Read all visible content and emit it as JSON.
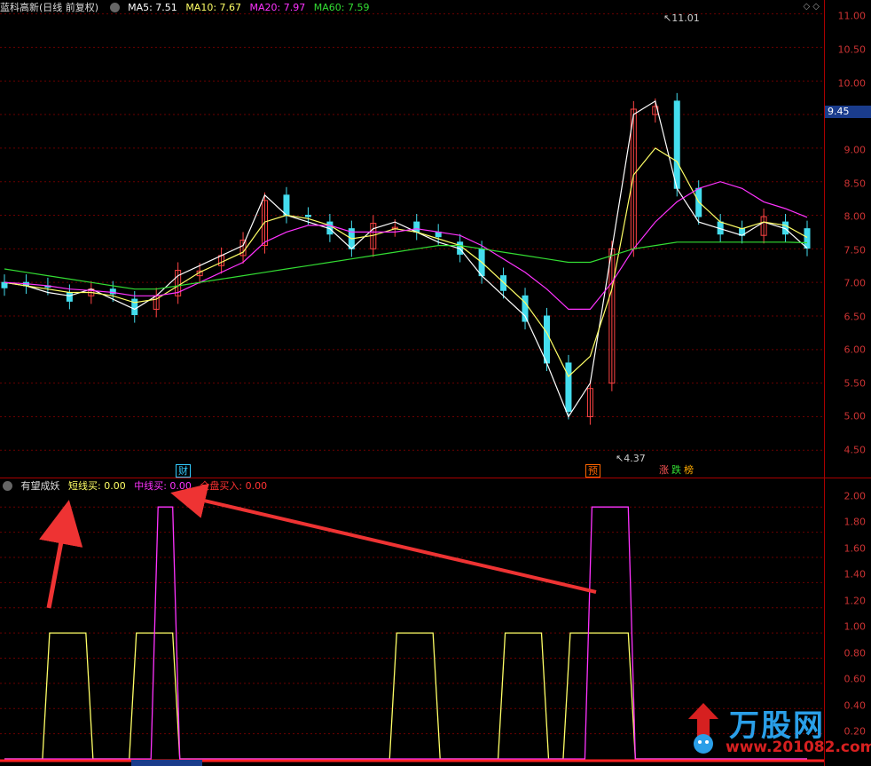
{
  "main_panel": {
    "title": "蓝科高新(日线 前复权)",
    "ma": [
      {
        "label": "MA5: 7.51",
        "color": "#ffffff"
      },
      {
        "label": "MA10: 7.67",
        "color": "#ffff66"
      },
      {
        "label": "MA20: 7.97",
        "color": "#ff33ff"
      },
      {
        "label": "MA60: 7.59",
        "color": "#33dd33"
      }
    ],
    "y_ticks": [
      "11.00",
      "10.50",
      "10.00",
      "9.45",
      "9.00",
      "8.50",
      "8.00",
      "7.50",
      "7.00",
      "6.50",
      "6.00",
      "5.50",
      "5.00",
      "4.50"
    ],
    "current_price": "9.45",
    "high_label": "11.01",
    "low_label": "4.37",
    "markers": [
      {
        "text": "财",
        "color": "#33ccff"
      },
      {
        "text": "预",
        "color": "#ff6600"
      },
      {
        "text": "涨",
        "color": "#ff5555"
      },
      {
        "text": "跌",
        "color": "#33dd33"
      },
      {
        "text": "榜",
        "color": "#ffaa00"
      }
    ],
    "window_controls": "◇ ◇"
  },
  "indicator_panel": {
    "title": "有望成妖",
    "series": [
      {
        "label": "短线买: 0.00",
        "color": "#ffff66"
      },
      {
        "label": "中线买: 0.00",
        "color": "#ff33ff"
      },
      {
        "label": "全盘买入: 0.00",
        "color": "#ff3333"
      }
    ],
    "y_ticks": [
      "2.00",
      "1.80",
      "1.60",
      "1.40",
      "1.20",
      "1.00",
      "0.80",
      "0.60",
      "0.40",
      "0.20"
    ]
  },
  "chart_data": [
    {
      "type": "line",
      "title": "蓝科高新(日线 前复权)",
      "ylim": [
        4.2,
        11.1
      ],
      "grid": true,
      "series": [
        {
          "name": "MA5",
          "values": [
            7.0,
            6.95,
            6.85,
            6.8,
            6.9,
            6.75,
            6.6,
            6.8,
            7.1,
            7.25,
            7.4,
            7.55,
            8.3,
            8.0,
            7.9,
            7.8,
            7.5,
            7.8,
            7.9,
            7.75,
            7.6,
            7.5,
            7.1,
            6.8,
            6.5,
            5.8,
            5.0,
            5.5,
            7.5,
            9.5,
            9.7,
            8.4,
            7.9,
            7.8,
            7.7,
            7.9,
            7.8,
            7.51
          ]
        },
        {
          "name": "MA10",
          "values": [
            7.0,
            6.95,
            6.9,
            6.85,
            6.85,
            6.8,
            6.7,
            6.75,
            6.95,
            7.15,
            7.3,
            7.45,
            7.9,
            8.0,
            7.95,
            7.85,
            7.65,
            7.7,
            7.8,
            7.75,
            7.65,
            7.55,
            7.3,
            7.0,
            6.7,
            6.25,
            5.6,
            5.9,
            6.9,
            8.6,
            9.0,
            8.8,
            8.2,
            7.9,
            7.8,
            7.9,
            7.85,
            7.67
          ]
        },
        {
          "name": "MA20",
          "values": [
            7.0,
            6.98,
            6.95,
            6.9,
            6.88,
            6.85,
            6.8,
            6.8,
            6.85,
            7.0,
            7.15,
            7.3,
            7.6,
            7.75,
            7.85,
            7.85,
            7.75,
            7.75,
            7.75,
            7.8,
            7.75,
            7.7,
            7.55,
            7.35,
            7.15,
            6.9,
            6.6,
            6.6,
            7.0,
            7.5,
            7.9,
            8.2,
            8.4,
            8.5,
            8.4,
            8.2,
            8.1,
            7.97
          ]
        },
        {
          "name": "MA60",
          "values": [
            7.2,
            7.15,
            7.1,
            7.05,
            7.0,
            6.95,
            6.9,
            6.9,
            6.95,
            7.0,
            7.05,
            7.1,
            7.15,
            7.2,
            7.25,
            7.3,
            7.35,
            7.4,
            7.45,
            7.5,
            7.55,
            7.55,
            7.5,
            7.45,
            7.4,
            7.35,
            7.3,
            7.3,
            7.4,
            7.5,
            7.55,
            7.6,
            7.6,
            7.6,
            7.6,
            7.6,
            7.6,
            7.59
          ]
        }
      ]
    },
    {
      "type": "line",
      "title": "有望成妖",
      "ylim": [
        0,
        2.1
      ],
      "grid": true,
      "series": [
        {
          "name": "短线买",
          "values": [
            0,
            0,
            1,
            1,
            0,
            0,
            1,
            1,
            0,
            0,
            0,
            0,
            0,
            0,
            0,
            0,
            0,
            0,
            1,
            1,
            0,
            0,
            0,
            1,
            1,
            0,
            1,
            1,
            1,
            0,
            0,
            0,
            0,
            0,
            0,
            0,
            0,
            0
          ]
        },
        {
          "name": "中线买",
          "values": [
            0,
            0,
            0,
            0,
            0,
            0,
            0,
            2,
            0,
            0,
            0,
            0,
            0,
            0,
            0,
            0,
            0,
            0,
            0,
            0,
            0,
            0,
            0,
            0,
            0,
            0,
            0,
            2,
            2,
            0,
            0,
            0,
            0,
            0,
            0,
            0,
            0,
            0
          ]
        }
      ]
    }
  ]
}
